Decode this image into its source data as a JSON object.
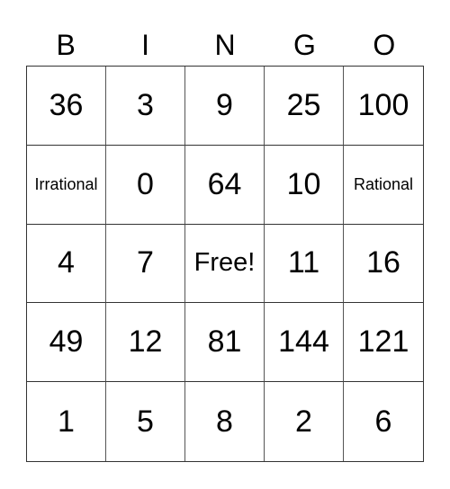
{
  "header": [
    "B",
    "I",
    "N",
    "G",
    "O"
  ],
  "rows": [
    [
      "36",
      "3",
      "9",
      "25",
      "100"
    ],
    [
      "Irrational",
      "0",
      "64",
      "10",
      "Rational"
    ],
    [
      "4",
      "7",
      "Free!",
      "11",
      "16"
    ],
    [
      "49",
      "12",
      "81",
      "144",
      "121"
    ],
    [
      "1",
      "5",
      "8",
      "2",
      "6"
    ]
  ]
}
